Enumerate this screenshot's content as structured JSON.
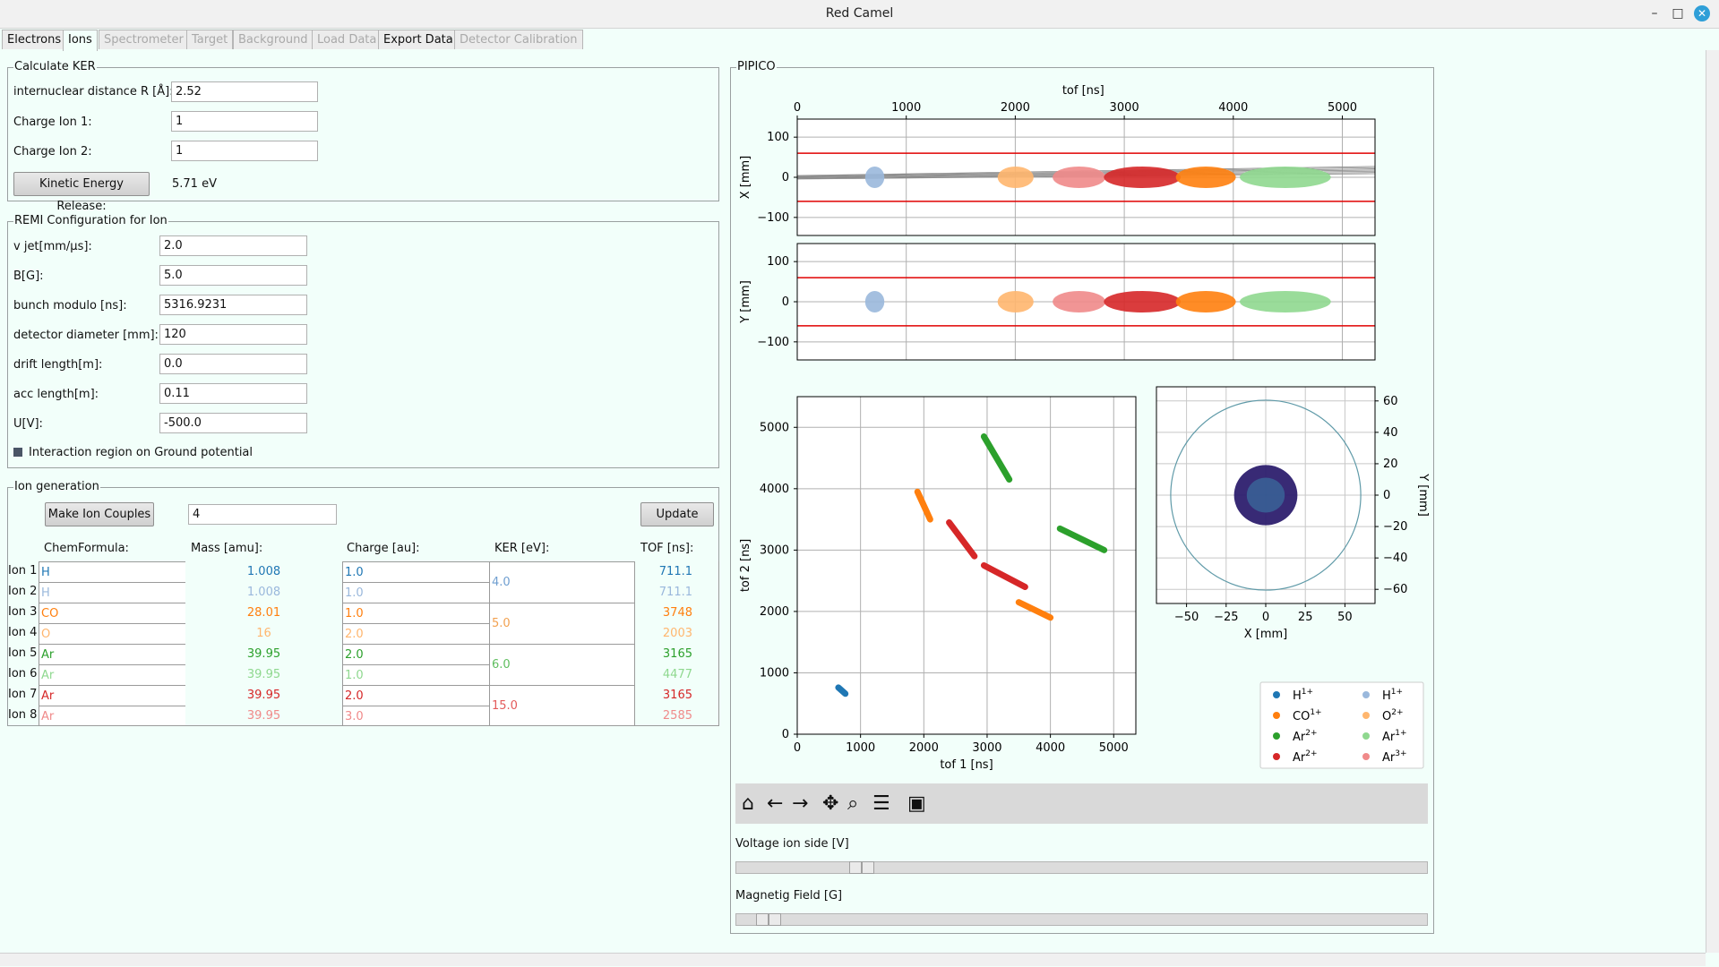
{
  "window": {
    "title": "Red Camel",
    "minimize": "–",
    "maximize": "□",
    "close": "✕"
  },
  "tabs": [
    {
      "label": "Electrons",
      "state": "enabled"
    },
    {
      "label": "Ions",
      "state": "active"
    },
    {
      "label": "Spectrometer",
      "state": "disabled"
    },
    {
      "label": "Target",
      "state": "disabled"
    },
    {
      "label": "Background",
      "state": "disabled"
    },
    {
      "label": "Load Data",
      "state": "disabled"
    },
    {
      "label": "Export Data",
      "state": "enabled"
    },
    {
      "label": "Detector Calibration",
      "state": "disabled"
    }
  ],
  "ker": {
    "title": "Calculate KER",
    "r_label": "internuclear distance R [Å]:",
    "r_value": "2.52",
    "q1_label": "Charge Ion 1:",
    "q1_value": "1",
    "q2_label": "Charge Ion 2:",
    "q2_value": "1",
    "button": "Kinetic Energy Release:",
    "result": "5.71 eV"
  },
  "remi": {
    "title": "REMI Configuration for Ion",
    "fields": [
      {
        "label": "v jet[mm/μs]:",
        "value": "2.0"
      },
      {
        "label": "B[G]:",
        "value": "5.0"
      },
      {
        "label": "bunch modulo [ns]:",
        "value": "5316.9231"
      },
      {
        "label": "detector diameter [mm]:",
        "value": "120"
      },
      {
        "label": "drift length[m]:",
        "value": "0.0"
      },
      {
        "label": "acc length[m]:",
        "value": "0.11"
      },
      {
        "label": "U[V]:",
        "value": "-500.0"
      }
    ],
    "checkbox_label": "Interaction region on Ground potential"
  },
  "iongen": {
    "title": "Ion generation",
    "make_button": "Make Ion Couples",
    "count": "4",
    "update_button": "Update",
    "headers": {
      "chem": "ChemFormula:",
      "mass": "Mass [amu]:",
      "charge": "Charge [au]:",
      "ker": "KER [eV]:",
      "tof": "TOF [ns]:"
    },
    "rows": [
      {
        "label": "Ion 1",
        "chem": "H",
        "mass": "1.008",
        "charge": "1.0",
        "tof": "711.1",
        "color": "#1f77b4"
      },
      {
        "label": "Ion 2",
        "chem": "H",
        "mass": "1.008",
        "charge": "1.0",
        "tof": "711.1",
        "color": "#9ab8dc"
      },
      {
        "label": "Ion 3",
        "chem": "CO",
        "mass": "28.01",
        "charge": "1.0",
        "tof": "3748",
        "color": "#ff7f0e"
      },
      {
        "label": "Ion 4",
        "chem": "O",
        "mass": "16",
        "charge": "2.0",
        "tof": "2003",
        "color": "#ffb66e"
      },
      {
        "label": "Ion 5",
        "chem": "Ar",
        "mass": "39.95",
        "charge": "2.0",
        "tof": "3165",
        "color": "#2ca02c"
      },
      {
        "label": "Ion 6",
        "chem": "Ar",
        "mass": "39.95",
        "charge": "1.0",
        "tof": "4477",
        "color": "#8fd88f"
      },
      {
        "label": "Ion 7",
        "chem": "Ar",
        "mass": "39.95",
        "charge": "2.0",
        "tof": "3165",
        "color": "#d62728"
      },
      {
        "label": "Ion 8",
        "chem": "Ar",
        "mass": "39.95",
        "charge": "3.0",
        "tof": "2585",
        "color": "#f08a8a"
      }
    ],
    "ker_values": [
      {
        "value": "4.0",
        "color": "#6f9ed0"
      },
      {
        "value": "5.0",
        "color": "#f2a150"
      },
      {
        "value": "6.0",
        "color": "#5fbe5f"
      },
      {
        "value": "15.0",
        "color": "#e35a5a"
      }
    ]
  },
  "pipico": {
    "title": "PIPICO",
    "toolbar_icons": [
      "home-icon",
      "back-arrow-icon",
      "forward-arrow-icon",
      "pan-icon",
      "zoom-icon",
      "configure-icon",
      "save-icon"
    ],
    "voltage_label": "Voltage ion side [V]",
    "voltage_level": 0.17,
    "field_label": "Magnetig Field [G]",
    "field_level": 0.03
  },
  "chart_data": [
    {
      "type": "scatter",
      "name": "tof-x",
      "xlabel": "tof [ns]",
      "ylabel": "X [mm]",
      "xlim": [
        0,
        5300
      ],
      "ylim": [
        -145,
        145
      ],
      "xticks": [
        "0",
        "1000",
        "2000",
        "3000",
        "4000",
        "5000"
      ],
      "yticks": [
        "100",
        "0",
        "−100"
      ],
      "detector_limits": [
        60,
        -60
      ],
      "blobs": [
        {
          "x": 711,
          "y": 0,
          "w": 80,
          "color": "#9ab8dc"
        },
        {
          "x": 2003,
          "y": 0,
          "w": 150,
          "color": "#ffb66e"
        },
        {
          "x": 2585,
          "y": 0,
          "w": 220,
          "color": "#f08a8a"
        },
        {
          "x": 3165,
          "y": 0,
          "w": 320,
          "color": "#d62728"
        },
        {
          "x": 3748,
          "y": 0,
          "w": 250,
          "color": "#ff7f0e"
        },
        {
          "x": 4477,
          "y": 0,
          "w": 380,
          "color": "#8fd88f"
        }
      ]
    },
    {
      "type": "scatter",
      "name": "tof-y",
      "ylabel": "Y [mm]",
      "xlim": [
        0,
        5300
      ],
      "ylim": [
        -145,
        145
      ],
      "yticks": [
        "100",
        "0",
        "−100"
      ],
      "detector_limits": [
        60,
        -60
      ]
    },
    {
      "type": "scatter",
      "name": "pipico",
      "xlabel": "tof 1 [ns]",
      "ylabel": "tof 2 [ns]",
      "xlim": [
        0,
        5350
      ],
      "ylim": [
        0,
        5500
      ],
      "xticks": [
        "0",
        "1000",
        "2000",
        "3000",
        "4000",
        "5000"
      ],
      "yticks": [
        "0",
        "1000",
        "2000",
        "3000",
        "4000",
        "5000"
      ],
      "segments": [
        {
          "x1": 650,
          "y1": 760,
          "x2": 760,
          "y2": 660,
          "color": "#1f77b4"
        },
        {
          "x1": 1900,
          "y1": 3950,
          "x2": 2100,
          "y2": 3500,
          "color": "#ff7f0e"
        },
        {
          "x1": 3500,
          "y1": 2150,
          "x2": 4000,
          "y2": 1900,
          "color": "#ff7f0e"
        },
        {
          "x1": 2950,
          "y1": 4850,
          "x2": 3350,
          "y2": 4150,
          "color": "#2ca02c"
        },
        {
          "x1": 4150,
          "y1": 3350,
          "x2": 4850,
          "y2": 3000,
          "color": "#2ca02c"
        },
        {
          "x1": 2400,
          "y1": 3450,
          "x2": 2800,
          "y2": 2900,
          "color": "#d62728"
        },
        {
          "x1": 2950,
          "y1": 2750,
          "x2": 3600,
          "y2": 2400,
          "color": "#d62728"
        }
      ]
    },
    {
      "type": "scatter",
      "name": "detector",
      "xlabel": "X [mm]",
      "ylabel": "Y [mm]",
      "xlim": [
        -69,
        69
      ],
      "ylim": [
        -69,
        69
      ],
      "xticks": [
        "−50",
        "−25",
        "0",
        "25",
        "50"
      ],
      "yticks": [
        "60",
        "40",
        "20",
        "0",
        "−20",
        "−40",
        "−60"
      ],
      "detector_radius": 60,
      "cloud_radius": 20,
      "cloud_color": "#2d1f6e"
    }
  ],
  "legend": [
    {
      "label": "H",
      "sup": "1+",
      "color": "#1f77b4"
    },
    {
      "label": "H",
      "sup": "1+",
      "color": "#9ab8dc"
    },
    {
      "label": "CO",
      "sup": "1+",
      "color": "#ff7f0e"
    },
    {
      "label": "O",
      "sup": "2+",
      "color": "#ffb66e"
    },
    {
      "label": "Ar",
      "sup": "2+",
      "color": "#2ca02c"
    },
    {
      "label": "Ar",
      "sup": "1+",
      "color": "#8fd88f"
    },
    {
      "label": "Ar",
      "sup": "2+",
      "color": "#d62728"
    },
    {
      "label": "Ar",
      "sup": "3+",
      "color": "#f08a8a"
    }
  ]
}
